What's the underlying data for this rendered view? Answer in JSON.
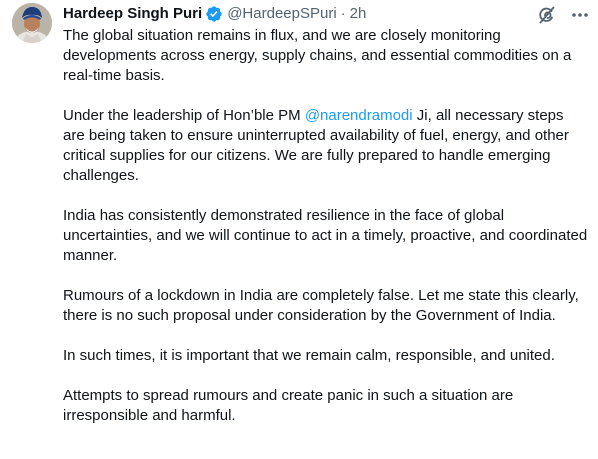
{
  "author": {
    "name": "Hardeep Singh Puri",
    "handle": "@HardeepSPuri",
    "separator": "·",
    "time": "2h",
    "verified_color": "#1d9bf0"
  },
  "icons": [
    "grok-icon",
    "more-icon"
  ],
  "tweet": {
    "p1": "The global situation remains in flux, and we are closely monitoring developments across energy, supply chains, and essential commodities on a real-time basis.",
    "p2_before": "Under the leadership of Hon’ble PM ",
    "p2_mention": "@narendramodi",
    "p2_after": " Ji, all necessary steps are being taken to ensure uninterrupted availability of fuel, energy, and other critical supplies for our citizens. We are fully prepared to handle emerging challenges.",
    "p3": "India has consistently demonstrated resilience in the face of global uncertainties, and we will continue to act in a timely, proactive, and coordinated manner.",
    "p4": "Rumours of a lockdown in India are completely false. Let me state this clearly, there is no such proposal under consideration by the Government of India.",
    "p5": "In such times, it is important that we remain calm, responsible, and united.",
    "p6": "Attempts to spread rumours and create panic in such a situation are irresponsible and harmful."
  }
}
